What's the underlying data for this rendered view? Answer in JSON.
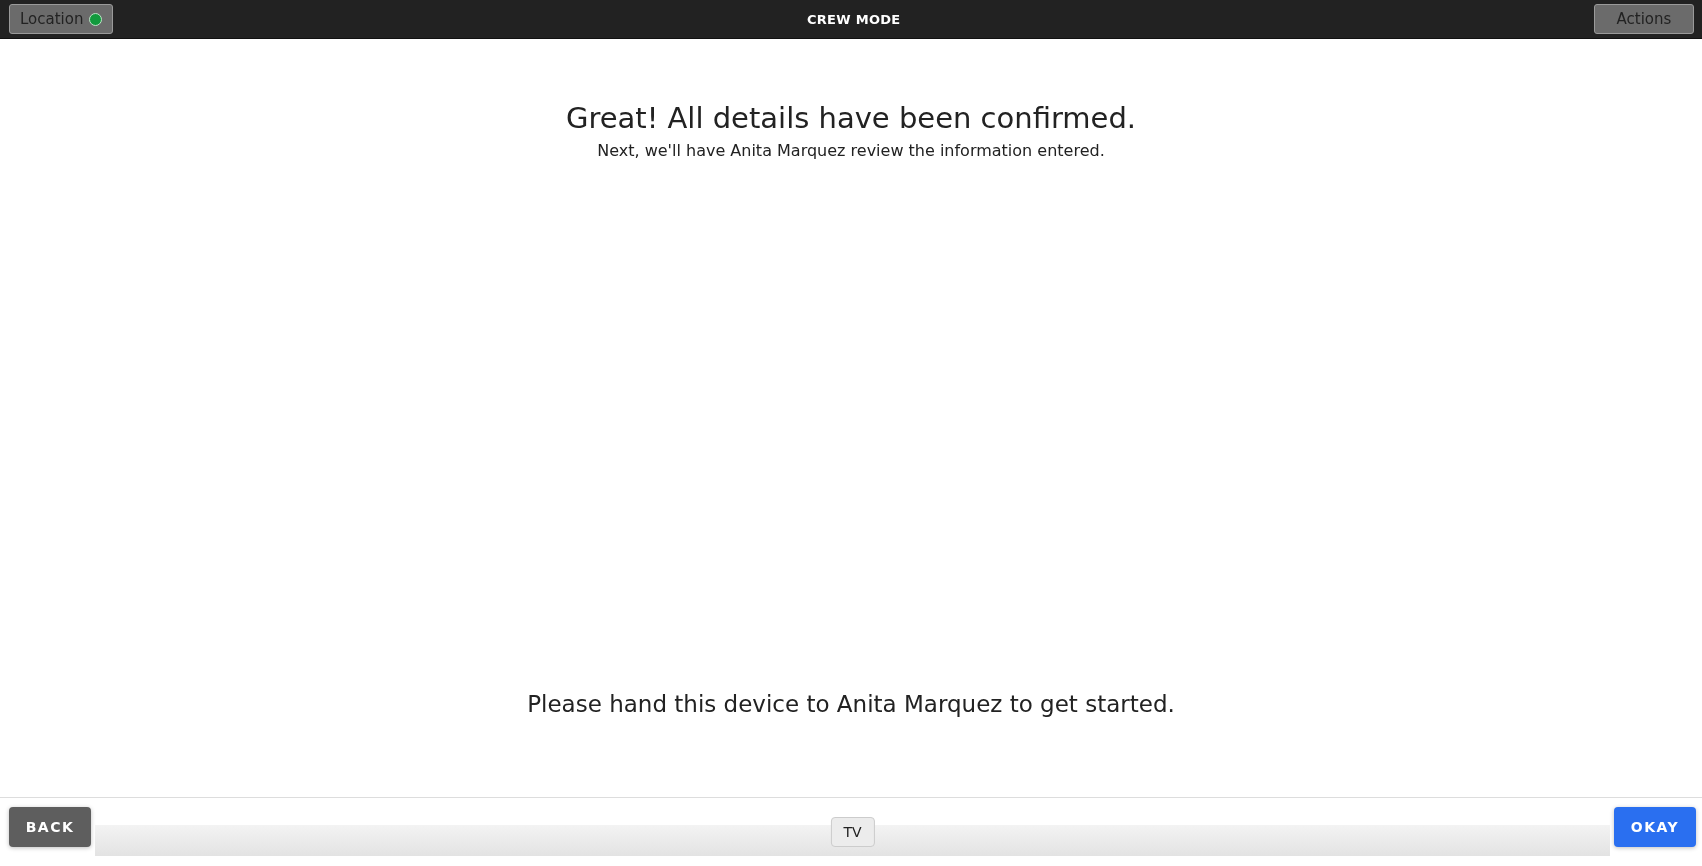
{
  "top_bar": {
    "title": "CREW MODE",
    "location_button": "Location",
    "actions_button": "Actions"
  },
  "heading": "Great! All details have been confirmed.",
  "subheading": "Next, we'll have Anita Marquez review the information entered.",
  "instruction": "Please hand this device to Anita Marquez to get started.",
  "footer": {
    "back_button": "BACK",
    "okay_button": "OKAY",
    "track_label": "TV"
  }
}
